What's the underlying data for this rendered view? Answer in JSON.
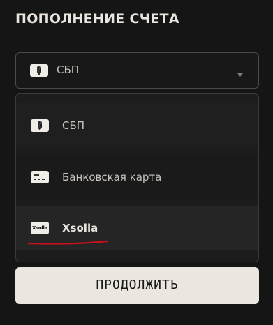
{
  "page": {
    "title": "ПОПОЛНЕНИЕ СЧЕТА"
  },
  "payment_select": {
    "selected_label": "СБП",
    "selected_icon": "sbp-icon"
  },
  "options": [
    {
      "label": "СБП",
      "icon": "sbp-icon"
    },
    {
      "label": "Банковская карта",
      "icon": "bank-card-icon"
    },
    {
      "label": "Xsolla",
      "icon": "xsolla-logo-icon",
      "logo_text": "Xsolla"
    }
  ],
  "submit": {
    "label": "ПРОДОЛЖИТЬ"
  },
  "colors": {
    "background": "#151515",
    "accent_underline": "#c8111b",
    "button_bg": "#ebe6df",
    "text_light": "#e9e4de"
  }
}
